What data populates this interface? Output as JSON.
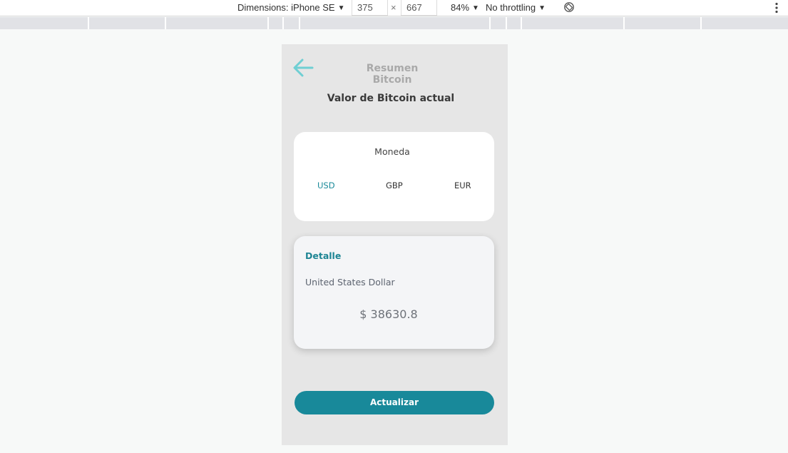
{
  "devtools": {
    "dimensions_label": "Dimensions: iPhone SE",
    "width_value": "375",
    "times": "×",
    "height_value": "667",
    "zoom": "84%",
    "throttling": "No throttling",
    "caret": "▼"
  },
  "app": {
    "title": "Resumen Bitcoin",
    "headline": "Valor de Bitcoin actual",
    "currency_label": "Moneda",
    "currencies": [
      "USD",
      "GBP",
      "EUR"
    ],
    "selected_currency": "USD",
    "detail": {
      "title": "Detalle",
      "currency_name": "United States Dollar",
      "price": "$ 38630.8"
    },
    "update_button": "Actualizar"
  },
  "colors": {
    "accent": "#18899a",
    "back_arrow": "#6fcfd3",
    "phone_bg": "#e6e6e6"
  },
  "icons": [
    "back-arrow-icon",
    "rotate-icon",
    "more-vert-icon"
  ]
}
